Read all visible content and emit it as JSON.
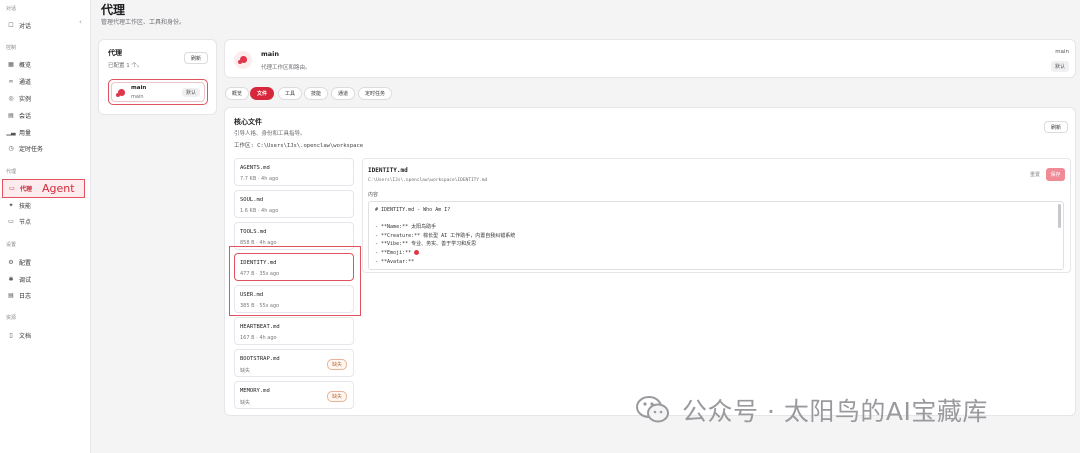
{
  "sidebar": {
    "collapse_icon": "chevron-left-icon",
    "sections": [
      {
        "title": "对话",
        "items": [
          {
            "label": "对话",
            "icon": "chat-icon"
          }
        ]
      },
      {
        "title": "控制",
        "items": [
          {
            "label": "概览",
            "icon": "grid-icon"
          },
          {
            "label": "通道",
            "icon": "link-icon"
          },
          {
            "label": "实例",
            "icon": "broadcast-icon"
          },
          {
            "label": "会话",
            "icon": "document-icon"
          },
          {
            "label": "用量",
            "icon": "bar-chart-icon"
          },
          {
            "label": "定时任务",
            "icon": "clock-icon"
          }
        ]
      },
      {
        "title": "代理",
        "items": [
          {
            "label": "代理",
            "icon": "folder-icon",
            "active": true,
            "annotation": "Agent"
          },
          {
            "label": "技能",
            "icon": "sparkle-icon"
          },
          {
            "label": "节点",
            "icon": "monitor-icon"
          }
        ]
      },
      {
        "title": "设置",
        "items": [
          {
            "label": "配置",
            "icon": "gear-icon"
          },
          {
            "label": "调试",
            "icon": "bug-icon"
          },
          {
            "label": "日志",
            "icon": "file-text-icon"
          }
        ]
      },
      {
        "title": "资源",
        "items": [
          {
            "label": "文档",
            "icon": "book-icon"
          }
        ]
      }
    ]
  },
  "header": {
    "title": "代理",
    "subtitle": "管理代理工作区、工具和身份。"
  },
  "agents_panel": {
    "title": "代理",
    "subtitle": "已配置 1 个。",
    "refresh_label": "刷新",
    "agents": [
      {
        "name": "main",
        "id": "main",
        "badge": "默认"
      }
    ]
  },
  "agent_header": {
    "name": "main",
    "description": "代理工作区和路由。",
    "id": "main",
    "badge": "默认"
  },
  "tabs": [
    {
      "label": "概览",
      "active": false
    },
    {
      "label": "文件",
      "active": true
    },
    {
      "label": "工具",
      "active": false
    },
    {
      "label": "技能",
      "active": false
    },
    {
      "label": "通道",
      "active": false
    },
    {
      "label": "定时任务",
      "active": false
    }
  ],
  "core_files": {
    "title": "核心文件",
    "subtitle": "引导人格、身份和工具指导。",
    "workspace": "工作区: C:\\Users\\IJs\\.openclaw\\workspace",
    "refresh_label": "刷新",
    "files": [
      {
        "name": "AGENTS.md",
        "meta": "7.7 KB · 4h ago",
        "missing": false,
        "selected": false
      },
      {
        "name": "SOUL.md",
        "meta": "1.6 KB · 4h ago",
        "missing": false,
        "selected": false
      },
      {
        "name": "TOOLS.md",
        "meta": "858 B · 4h ago",
        "missing": false,
        "selected": false
      },
      {
        "name": "IDENTITY.md",
        "meta": "477 B · 35s ago",
        "missing": false,
        "selected": true
      },
      {
        "name": "USER.md",
        "meta": "385 B · 55s ago",
        "missing": false,
        "selected": false
      },
      {
        "name": "HEARTBEAT.md",
        "meta": "167 B · 4h ago",
        "missing": false,
        "selected": false
      },
      {
        "name": "BOOTSTRAP.md",
        "meta": "缺失",
        "missing": true,
        "selected": false,
        "badge": "缺失"
      },
      {
        "name": "MEMORY.md",
        "meta": "缺失",
        "missing": true,
        "selected": false,
        "badge": "缺失"
      }
    ]
  },
  "editor": {
    "file_name": "IDENTITY.md",
    "file_path": "C:\\Users\\IJs\\.openclaw\\workspace\\IDENTITY.md",
    "content_label": "内容",
    "reset_label": "重置",
    "save_label": "保存",
    "lines": [
      "# IDENTITY.md - Who Am I?",
      "",
      "- **Name:** 太阳鸟助手",
      "- **Creature:** 棕长型 AI 工作助手，内置自我纠错系统",
      "- **Vibe:** 专业、务实、善于学习和反思",
      "- **Emoji:** ",
      "- **Avatar:**"
    ]
  },
  "watermark": {
    "text": "公众号 · 太阳鸟的AI宝藏库",
    "icon": "wechat-icon"
  },
  "colors": {
    "accent": "#d7283b",
    "highlight_border": "#e2525f",
    "background": "#f4f4f5"
  }
}
